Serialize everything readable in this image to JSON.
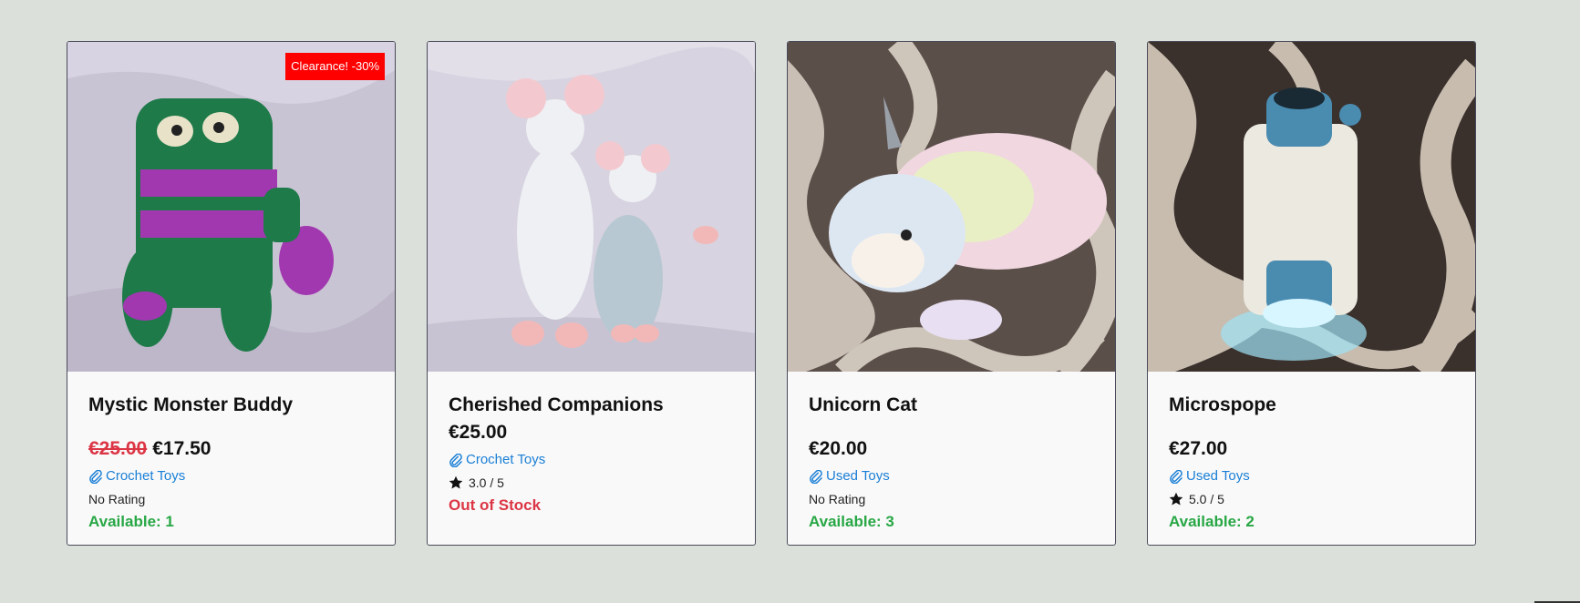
{
  "products": [
    {
      "title": "Mystic Monster Buddy",
      "badge": "Clearance! -30%",
      "old_price": "€25.00",
      "price": "€17.50",
      "category": "Crochet Toys",
      "rating": "No Rating",
      "stock": "Available: 1"
    },
    {
      "title": "Cherished Companions",
      "price": "€25.00",
      "category": "Crochet Toys",
      "rating": "3.0 / 5",
      "stock": "Out of Stock"
    },
    {
      "title": "Unicorn Cat",
      "price": "€20.00",
      "category": "Used Toys",
      "rating": "No Rating",
      "stock": "Available: 3"
    },
    {
      "title": "Microspope",
      "price": "€27.00",
      "category": "Used Toys",
      "rating": "5.0 / 5",
      "stock": "Available: 2"
    }
  ],
  "colors": {
    "background": "#dbe0db",
    "link": "#1a7fd6",
    "available": "#28a745",
    "out_of_stock": "#dc3545",
    "badge": "#ff0000"
  },
  "icons": {
    "category": "paperclip-icon",
    "rating": "star-icon"
  }
}
